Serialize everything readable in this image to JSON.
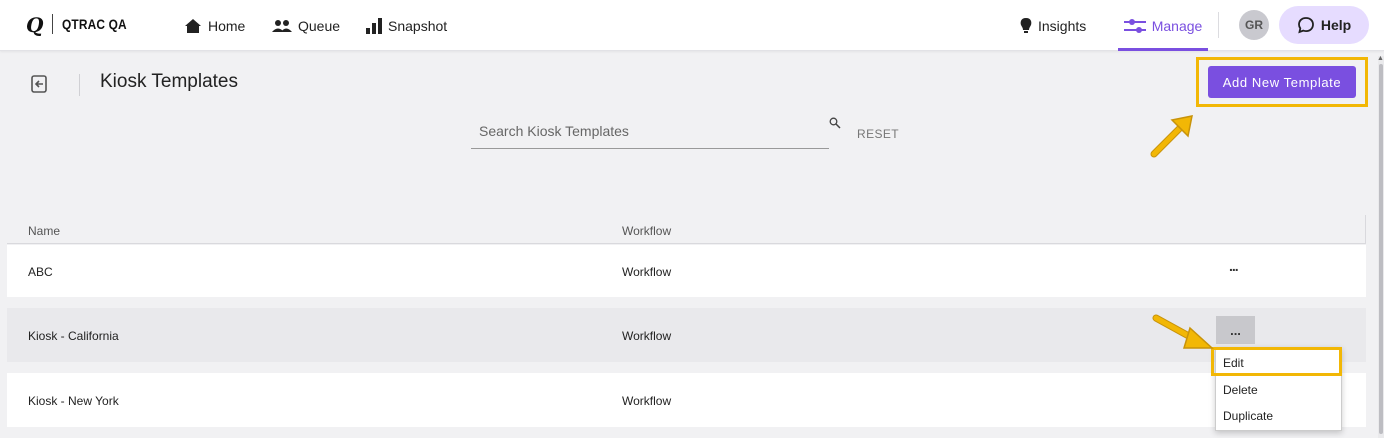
{
  "app": {
    "logo_mark": "Q",
    "name": "QTRAC QA"
  },
  "nav": {
    "home": "Home",
    "queue": "Queue",
    "snapshot": "Snapshot",
    "insights": "Insights",
    "manage": "Manage"
  },
  "user": {
    "initials": "GR"
  },
  "help": {
    "label": "Help"
  },
  "page": {
    "title": "Kiosk Templates",
    "add_button": "Add New Template"
  },
  "search": {
    "placeholder": "Search Kiosk Templates",
    "reset": "RESET"
  },
  "table": {
    "columns": [
      "Name",
      "Workflow"
    ],
    "rows": [
      {
        "name": "ABC",
        "workflow": "Workflow",
        "actions": "..."
      },
      {
        "name": "Kiosk - California",
        "workflow": "Workflow",
        "actions": "..."
      },
      {
        "name": "Kiosk - New York",
        "workflow": "Workflow",
        "actions": "..."
      }
    ]
  },
  "row_menu": {
    "items": [
      "Edit",
      "Delete",
      "Duplicate"
    ]
  },
  "colors": {
    "accent": "#7a4fe0",
    "highlight": "#f2b705",
    "help_bg": "#e6dcff"
  }
}
